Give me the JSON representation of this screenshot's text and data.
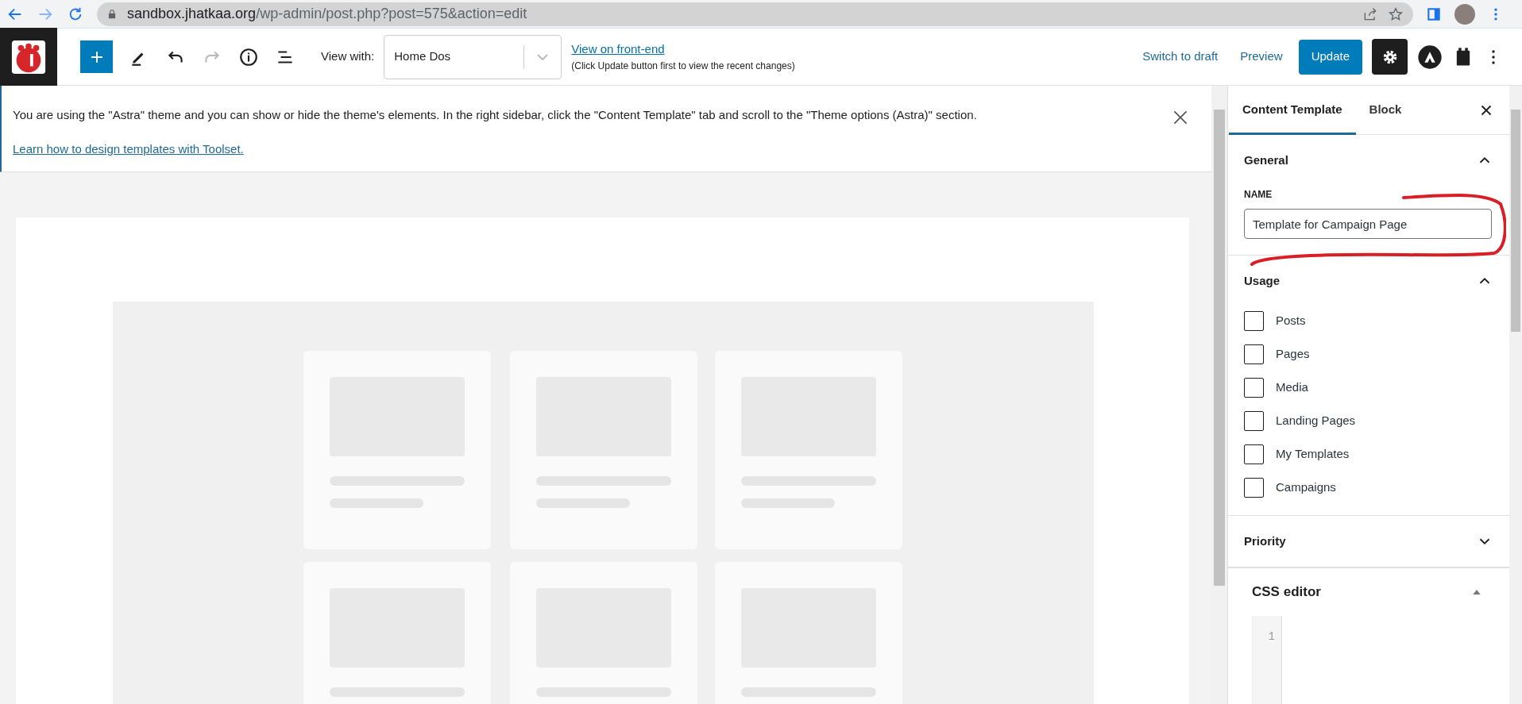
{
  "browser": {
    "url_host": "sandbox.jhatkaa.org",
    "url_path": "/wp-admin/post.php?post=575&action=edit"
  },
  "toolbar": {
    "view_with_label": "View with:",
    "view_with_value": "Home Dos",
    "front_end_link": "View on front-end",
    "front_end_note": "(Click Update button first to view the recent changes)",
    "switch_to_draft": "Switch to draft",
    "preview": "Preview",
    "update": "Update"
  },
  "notice": {
    "text": "You are using the \"Astra\" theme and you can show or hide the theme's elements. In the right sidebar, click the \"Content Template\" tab and scroll to the \"Theme options (Astra)\" section.",
    "link": "Learn how to design templates with Toolset."
  },
  "sidebar": {
    "tabs": [
      {
        "label": "Content Template",
        "selected": true
      },
      {
        "label": "Block",
        "selected": false
      }
    ],
    "general": {
      "title": "General",
      "expanded": true,
      "name_label": "NAME",
      "name_value": "Template for Campaign Page"
    },
    "usage": {
      "title": "Usage",
      "expanded": true,
      "options": [
        {
          "label": "Posts",
          "checked": false
        },
        {
          "label": "Pages",
          "checked": false
        },
        {
          "label": "Media",
          "checked": false
        },
        {
          "label": "Landing Pages",
          "checked": false
        },
        {
          "label": "My Templates",
          "checked": false
        },
        {
          "label": "Campaigns",
          "checked": false
        }
      ]
    },
    "priority": {
      "title": "Priority",
      "expanded": false
    },
    "css_editor": {
      "title": "CSS editor",
      "expanded": true,
      "line_numbers": [
        "1"
      ]
    }
  }
}
